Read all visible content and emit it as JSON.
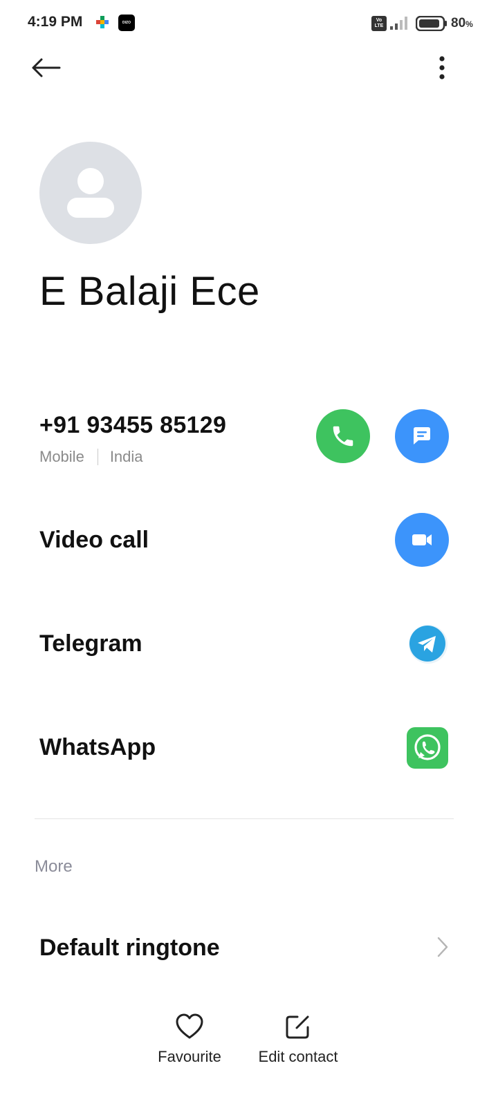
{
  "status_bar": {
    "time": "4:19 PM",
    "notification_icons": [
      "google-play-games-icon",
      "dizo-icon"
    ],
    "dizo_label": "DIZO",
    "volte_label": "Vo LTE",
    "battery_level": "80",
    "battery_unit": "%"
  },
  "top_bar": {
    "back_icon": "arrow-left-icon",
    "more_icon": "more-vertical-icon"
  },
  "contact": {
    "name": "E Balaji Ece",
    "avatar_icon": "person-placeholder-icon"
  },
  "phone": {
    "number": "+91 93455 85129",
    "type": "Mobile",
    "country": "India"
  },
  "actions": [
    {
      "label": "Video call",
      "icon": "video-camera-icon"
    },
    {
      "label": "Telegram",
      "icon": "telegram-icon"
    },
    {
      "label": "WhatsApp",
      "icon": "whatsapp-icon"
    }
  ],
  "more_section": {
    "title": "More",
    "items": [
      {
        "label": "Default ringtone",
        "icon": "chevron-right-icon"
      }
    ]
  },
  "bottom_bar": {
    "favourite_label": "Favourite",
    "edit_label": "Edit contact"
  },
  "colors": {
    "call_green": "#3ec35f",
    "action_blue": "#3c94fb",
    "telegram_blue": "#2aa3e1",
    "whatsapp_green": "#3ec35f",
    "avatar_gray": "#dde0e5"
  }
}
